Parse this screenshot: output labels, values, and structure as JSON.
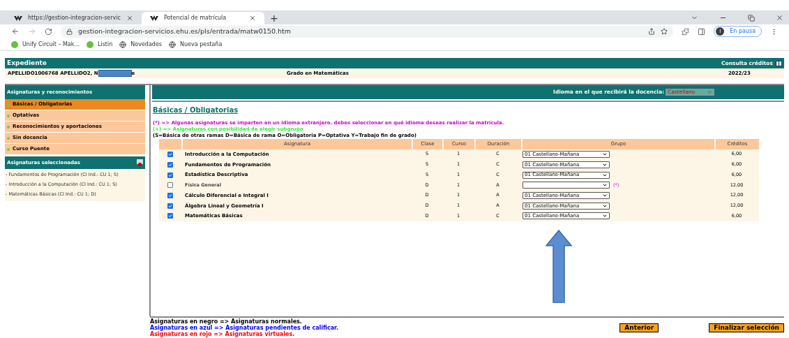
{
  "browser": {
    "tabs": [
      {
        "title": "https://gestion-integracion-servic",
        "selected": false
      },
      {
        "title": "Potencial de matrícula",
        "selected": true
      }
    ],
    "new_tab": "+",
    "url": "gestion-integracion-servicios.ehu.es/pls/entrada/matw0150.htm",
    "profile": {
      "initial": "I",
      "status": "En pausa"
    },
    "bookmarks": [
      "Unify Circuit – Mak...",
      "Listin",
      "Novedades",
      "Nueva pestaña"
    ]
  },
  "expediente": {
    "title": "Expediente",
    "link": "Consulta créditos",
    "name_start": "APELLIDO1006768 APELLIDO2, N",
    "name_end": "e",
    "degree": "Grado en Matemáticas",
    "year": "2022/23"
  },
  "sidebar": {
    "title": "Asignaturas y reconocimientos",
    "items": [
      {
        "label": "Básicas / Obligatorias",
        "selected": true
      },
      {
        "label": "Optativas",
        "selected": false
      },
      {
        "label": "Reconocimientos y aportaciones",
        "selected": false
      },
      {
        "label": "Sin docencia",
        "selected": false
      },
      {
        "label": "Curso Puente",
        "selected": false
      }
    ],
    "selected_title": "Asignaturas seleccionadas",
    "selected_items": [
      "- Fundamentos de Programación (CI Ind.: CU 1; S)",
      "- Introducción a la Computación (CI Ind.: CU 1; S)",
      "- Matemáticas Básicas (CI Ind.: CU 1; D)"
    ]
  },
  "language": {
    "label": "Idioma en el que recibirá la docencia:",
    "value": "Castellano"
  },
  "section_title": "Básicas / Obligatorias",
  "notes": [
    {
      "text": "(*) => Algunas asignaturas se imparten en un idioma extranjero. debes seleccionar en qué idioma deseas realizar la matrícula.",
      "color": "#cc00cc"
    },
    {
      "text": "(+) => Asignaturas con posibilidad de elegir subgrupo",
      "color": "#33ee33"
    },
    {
      "text": "(S=Básica de otras ramas D=Básica de rama O=Obligatoria P=Optativa Y=Trabajo fin de grado)",
      "color": "#000000"
    }
  ],
  "table": {
    "columns": [
      "Asignatura",
      "Clase",
      "Curso",
      "Duración",
      "Grupo",
      "Créditos"
    ],
    "rows": [
      {
        "checked": true,
        "asignatura": "Introducción a la Computación",
        "clase": "S",
        "curso": "1",
        "duracion": "C",
        "grupo": "01 Castellano-Mañana",
        "creditos": "6,00"
      },
      {
        "checked": true,
        "asignatura": "Fundamentos de Programación",
        "clase": "S",
        "curso": "1",
        "duracion": "C",
        "grupo": "01 Castellano-Mañana",
        "creditos": "6,00"
      },
      {
        "checked": true,
        "asignatura": "Estadística Descriptiva",
        "clase": "S",
        "curso": "1",
        "duracion": "C",
        "grupo": "01 Castellano-Mañana",
        "creditos": "6,00"
      },
      {
        "checked": false,
        "asignatura": "Física General",
        "clase": "D",
        "curso": "1",
        "duracion": "A",
        "grupo": "",
        "note": "(*)",
        "creditos": "12,00"
      },
      {
        "checked": true,
        "asignatura": "Cálculo Diferencial e Integral I",
        "clase": "D",
        "curso": "1",
        "duracion": "A",
        "grupo": "01 Castellano-Mañana",
        "creditos": "12,00"
      },
      {
        "checked": true,
        "asignatura": "Álgebra Lineal y Geometría I",
        "clase": "D",
        "curso": "1",
        "duracion": "A",
        "grupo": "01 Castellano-Mañana",
        "creditos": "12,00"
      },
      {
        "checked": true,
        "asignatura": "Matemáticas Básicas",
        "clase": "D",
        "curso": "1",
        "duracion": "C",
        "grupo": "01 Castellano-Mañana",
        "creditos": "6,00"
      }
    ]
  },
  "legend": [
    {
      "text": "Asignaturas en negro => Asignaturas normales.",
      "color": "#000000"
    },
    {
      "text": "Asignaturas en azul => Asignaturas pendientes de calificar.",
      "color": "#0000ff"
    },
    {
      "text": "Asignaturas en rojo => Asignaturas virtuales.",
      "color": "#ff0000"
    }
  ],
  "buttons": [
    "Anterior",
    "Finalizar selección"
  ]
}
